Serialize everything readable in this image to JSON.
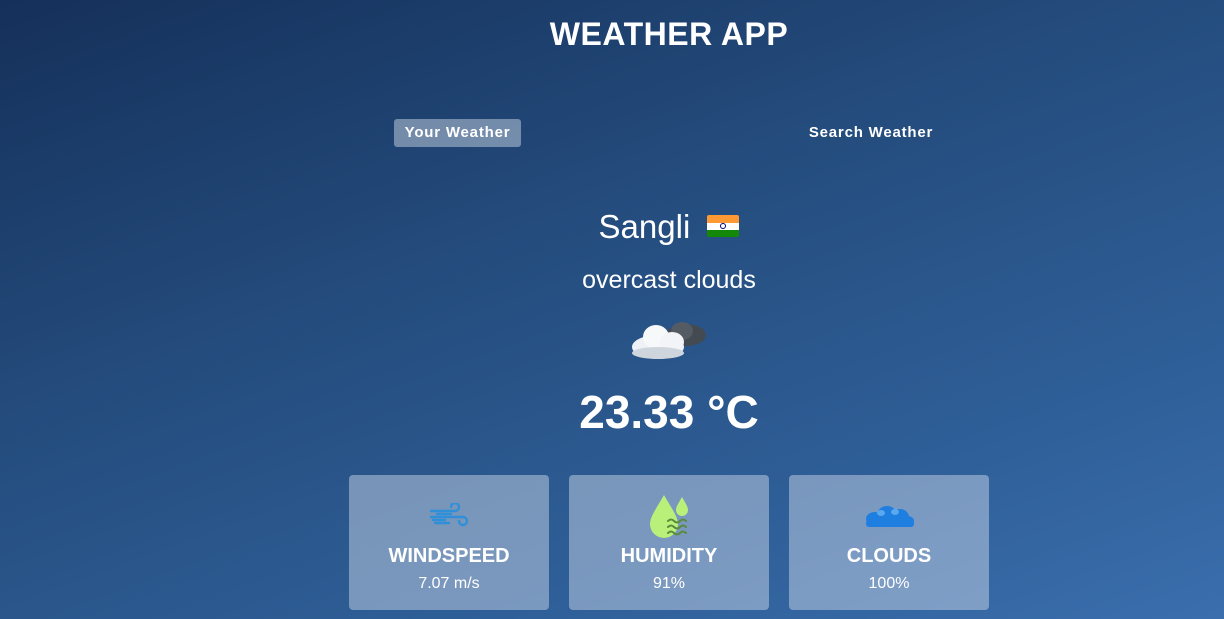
{
  "app": {
    "title": "WEATHER APP"
  },
  "tabs": [
    {
      "label": "Your Weather",
      "active": true
    },
    {
      "label": "Search Weather",
      "active": false
    }
  ],
  "location": {
    "city": "Sangli",
    "country_flag": "india-flag-icon"
  },
  "weather": {
    "description": "overcast clouds",
    "icon": "overcast-cloud-icon",
    "temperature": "23.33 °C"
  },
  "cards": {
    "windspeed": {
      "label": "WINDSPEED",
      "value": "7.07 m/s",
      "icon": "wind-icon"
    },
    "humidity": {
      "label": "HUMIDITY",
      "value": "91%",
      "icon": "humidity-drop-icon"
    },
    "clouds": {
      "label": "CLOUDS",
      "value": "100%",
      "icon": "clouds-icon"
    }
  },
  "colors": {
    "bg_top": "#15305a",
    "bg_bottom": "#3a6ead",
    "wind_icon": "#2f8fd8",
    "humidity_icon": "#b8f07a",
    "clouds_icon": "#1f7fe0"
  }
}
